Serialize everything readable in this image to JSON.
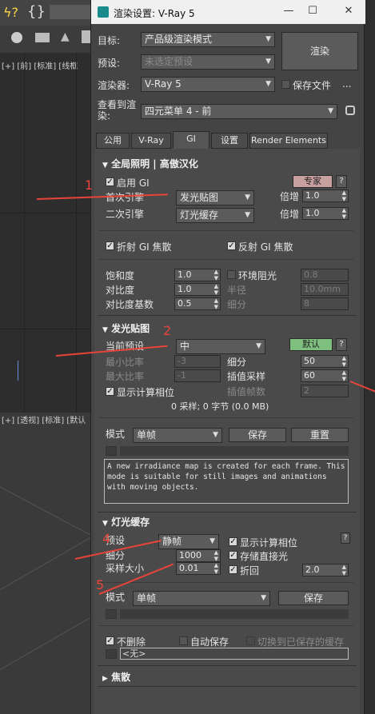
{
  "bg": {
    "vp_top_label": "[+] [前] [标准] [线框",
    "vp_bot_label": "[+] [透视] [标准] [默认"
  },
  "dialog": {
    "title": "渲染设置: V-Ray 5",
    "minimize": "—",
    "maximize": "☐",
    "close": "✕",
    "target_label": "目标:",
    "target_value": "产品级渲染模式",
    "preset_label": "预设:",
    "preset_value": "未选定预设",
    "renderer_label": "渲染器:",
    "renderer_value": "V-Ray 5",
    "save_file_label": "保存文件",
    "ellipsis": "...",
    "render_button": "渲染",
    "view_label": "查看到渲染:",
    "view_value": "四元菜单 4 - 前",
    "lock_icon": "lock-icon"
  },
  "tabs": [
    "公用",
    "V-Ray",
    "GI",
    "设置",
    "Render Elements"
  ],
  "gi": {
    "header": "全局照明 | 高傲汉化",
    "enable_gi": "启用 GI",
    "expert_button": "专家",
    "help": "?",
    "primary_label": "首次引擎",
    "primary_value": "发光贴图",
    "primary_mult_label": "倍增",
    "primary_mult": "1.0",
    "secondary_label": "二次引擎",
    "secondary_value": "灯光缓存",
    "secondary_mult_label": "倍增",
    "secondary_mult": "1.0",
    "refractive_caustics": "折射 GI 焦散",
    "reflective_caustics": "反射 GI 焦散",
    "saturation_label": "饱和度",
    "saturation": "1.0",
    "contrast_label": "对比度",
    "contrast": "1.0",
    "contrast_base_label": "对比度基数",
    "contrast_base": "0.5",
    "ao_label": "环境阻光",
    "ao_value": "0.8",
    "radius_label": "半径",
    "radius_value": "10.0mm",
    "subdivs_label": "细分",
    "subdivs_value": "8"
  },
  "irradiance": {
    "header": "发光贴图",
    "preset_label": "当前预设",
    "preset_value": "中",
    "default_button": "默认",
    "help": "?",
    "min_rate_label": "最小比率",
    "min_rate": "-3",
    "max_rate_label": "最大比率",
    "max_rate": "-1",
    "subdivs_label": "细分",
    "subdivs": "50",
    "interp_label": "插值采样",
    "interp": "60",
    "show_calc": "显示计算相位",
    "interp_frames_label": "插值帧数",
    "interp_frames": "2",
    "stats": "0 采样; 0 字节 (0.0 MB)",
    "mode_label": "模式",
    "mode_value": "单帧",
    "save_button": "保存",
    "reset_button": "重置",
    "desc": "A new irradiance map is created for each frame. This mode is suitable for still images and animations with moving objects."
  },
  "lightcache": {
    "header": "灯光缓存",
    "preset_label": "预设",
    "preset_value": "静帧",
    "show_calc": "显示计算相位",
    "store_direct": "存储直接光",
    "retrace": "折回",
    "retrace_value": "2.0",
    "subdivs_label": "细分",
    "subdivs": "1000",
    "sample_size_label": "采样大小",
    "sample_size": "0.01",
    "help": "?",
    "mode_label": "模式",
    "mode_value": "单帧",
    "save_button": "保存",
    "dont_delete": "不删除",
    "auto_save": "自动保存",
    "switch_saved": "切换到已保存的缓存",
    "file_value": "<无>"
  },
  "caustics": {
    "header": "焦散"
  },
  "annotations": [
    "1",
    "2",
    "4",
    "5"
  ],
  "colors": {
    "annotation": "#e8443a",
    "dialog_bg": "#444444",
    "expert_button": "#c9a0a0",
    "default_button": "#7fbf7f"
  }
}
